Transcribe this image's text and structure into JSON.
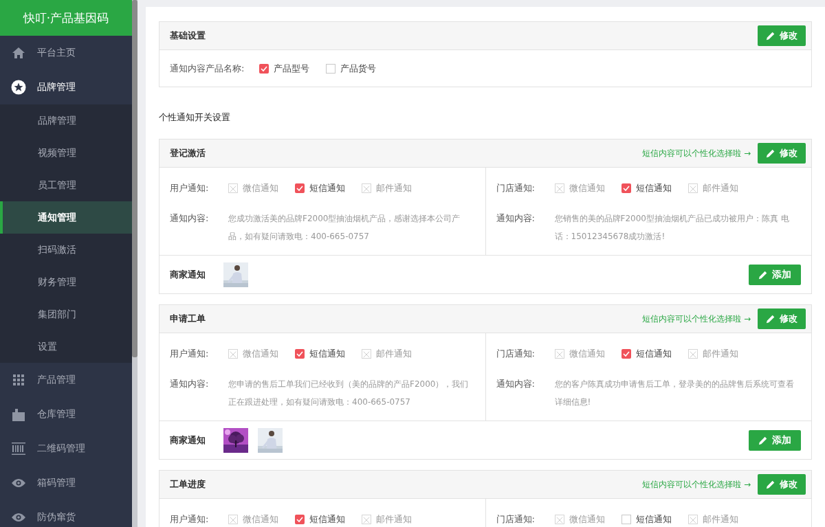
{
  "sidebar": {
    "logo": "快叮·产品基因码",
    "items": [
      {
        "label": "平台主页",
        "expanded": false
      },
      {
        "label": "品牌管理",
        "expanded": true,
        "children": [
          {
            "label": "品牌管理",
            "selected": false
          },
          {
            "label": "视频管理",
            "selected": false
          },
          {
            "label": "员工管理",
            "selected": false
          },
          {
            "label": "通知管理",
            "selected": true
          },
          {
            "label": "扫码激活",
            "selected": false
          },
          {
            "label": "财务管理",
            "selected": false
          },
          {
            "label": "集团部门",
            "selected": false
          },
          {
            "label": "设置",
            "selected": false
          }
        ]
      },
      {
        "label": "产品管理",
        "expanded": false
      },
      {
        "label": "仓库管理",
        "expanded": false
      },
      {
        "label": "二维码管理",
        "expanded": false
      },
      {
        "label": "箱码管理",
        "expanded": false
      },
      {
        "label": "防伪窜货",
        "expanded": false
      }
    ]
  },
  "basic": {
    "title": "基础设置",
    "edit_button": "修改",
    "label": "通知内容产品名称:",
    "options": [
      {
        "label": "产品型号",
        "checked": true
      },
      {
        "label": "产品货号",
        "checked": false
      }
    ]
  },
  "section_heading": "个性通知开关设置",
  "sections": [
    {
      "title": "登记激活",
      "hint": "短信内容可以个性化选择啦 →",
      "edit_button": "修改",
      "columns": [
        {
          "label": "用户通知:",
          "options": [
            {
              "label": "微信通知",
              "checked": false,
              "disabled": true
            },
            {
              "label": "短信通知",
              "checked": true,
              "disabled": false
            },
            {
              "label": "邮件通知",
              "checked": false,
              "disabled": true
            }
          ],
          "content_label": "通知内容:",
          "content": "您成功激活美的品牌F2000型抽油烟机产品，感谢选择本公司产品，如有疑问请致电：400-665-0757"
        },
        {
          "label": "门店通知:",
          "options": [
            {
              "label": "微信通知",
              "checked": false,
              "disabled": true
            },
            {
              "label": "短信通知",
              "checked": true,
              "disabled": false
            },
            {
              "label": "邮件通知",
              "checked": false,
              "disabled": true
            }
          ],
          "content_label": "通知内容:",
          "content": "您销售的美的品牌F2000型抽油烟机产品已成功被用户：陈真 电话：15012345678成功激活!"
        }
      ],
      "merchant_label": "商家通知",
      "thumbs": [
        {
          "kind": "picture"
        }
      ],
      "add_button": "添加"
    },
    {
      "title": "申请工单",
      "hint": "短信内容可以个性化选择啦 →",
      "edit_button": "修改",
      "columns": [
        {
          "label": "用户通知:",
          "options": [
            {
              "label": "微信通知",
              "checked": false,
              "disabled": true
            },
            {
              "label": "短信通知",
              "checked": true,
              "disabled": false
            },
            {
              "label": "邮件通知",
              "checked": false,
              "disabled": true
            }
          ],
          "content_label": "通知内容:",
          "content": "您申请的售后工单我们已经收到（美的品牌的产品F2000），我们正在跟进处理，如有疑问请致电：400-665-0757"
        },
        {
          "label": "门店通知:",
          "options": [
            {
              "label": "微信通知",
              "checked": false,
              "disabled": true
            },
            {
              "label": "短信通知",
              "checked": true,
              "disabled": false
            },
            {
              "label": "邮件通知",
              "checked": false,
              "disabled": true
            }
          ],
          "content_label": "通知内容:",
          "content": "您的客户陈真成功申请售后工单，登录美的的品牌售后系统可查看详细信息!"
        }
      ],
      "merchant_label": "商家通知",
      "thumbs": [
        {
          "kind": "picture"
        },
        {
          "kind": "picture"
        }
      ],
      "add_button": "添加"
    },
    {
      "title": "工单进度",
      "hint": "短信内容可以个性化选择啦 →",
      "edit_button": "修改",
      "columns": [
        {
          "label": "用户通知:",
          "options": [
            {
              "label": "微信通知",
              "checked": false,
              "disabled": true
            },
            {
              "label": "短信通知",
              "checked": true,
              "disabled": false
            },
            {
              "label": "邮件通知",
              "checked": false,
              "disabled": true
            }
          ]
        },
        {
          "label": "门店通知:",
          "options": [
            {
              "label": "微信通知",
              "checked": false,
              "disabled": true
            },
            {
              "label": "短信通知",
              "checked": false,
              "disabled": false
            },
            {
              "label": "邮件通知",
              "checked": false,
              "disabled": true
            }
          ]
        }
      ]
    }
  ]
}
